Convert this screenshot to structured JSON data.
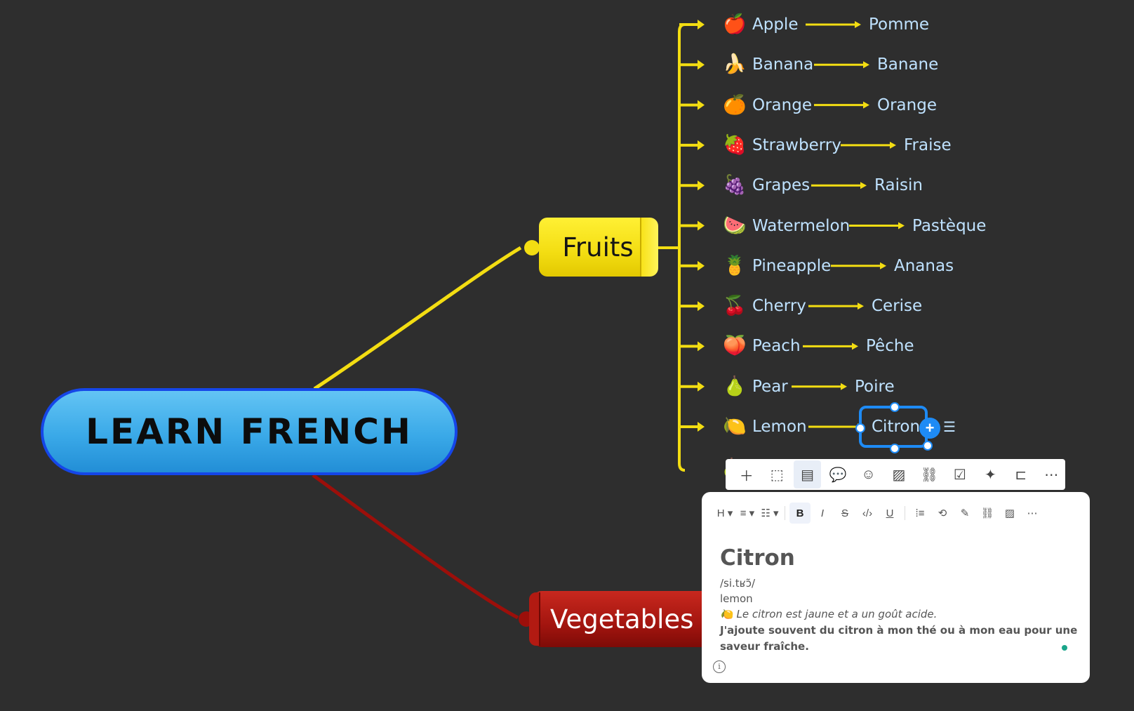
{
  "root": {
    "label": "LEARN FRENCH"
  },
  "branches": {
    "fruits": "Fruits",
    "vegetables": "Vegetables"
  },
  "colors": {
    "fruits": "#f3dd12",
    "vegetables": "#a3150f",
    "root_border": "#1546e8",
    "selection": "#1e8bf5",
    "leaf_text": "#bfe2ff"
  },
  "fruit_items": [
    {
      "emoji": "🍎",
      "en": "Apple",
      "fr": "Pomme"
    },
    {
      "emoji": "🍌",
      "en": "Banana",
      "fr": "Banane"
    },
    {
      "emoji": "🍊",
      "en": "Orange",
      "fr": "Orange"
    },
    {
      "emoji": "🍓",
      "en": "Strawberry",
      "fr": "Fraise"
    },
    {
      "emoji": "🍇",
      "en": "Grapes",
      "fr": "Raisin"
    },
    {
      "emoji": "🍉",
      "en": "Watermelon",
      "fr": "Pastèque"
    },
    {
      "emoji": "🍍",
      "en": "Pineapple",
      "fr": "Ananas"
    },
    {
      "emoji": "🍒",
      "en": "Cherry",
      "fr": "Cerise"
    },
    {
      "emoji": "🍑",
      "en": "Peach",
      "fr": "Pêche"
    },
    {
      "emoji": "🍐",
      "en": "Pear",
      "fr": "Poire"
    },
    {
      "emoji": "🍋",
      "en": "Lemon",
      "fr": "Citron"
    }
  ],
  "selected_node": "Citron",
  "floating_toolbar": [
    "add-topic-icon",
    "text-box-icon",
    "note-icon",
    "comment-icon",
    "emoji-icon",
    "image-icon",
    "link-icon",
    "task-icon",
    "ai-sparkle-icon",
    "structure-icon",
    "more-icon"
  ],
  "note_toolbar": [
    "heading-icon",
    "align-icon",
    "list-icon",
    "bold-icon",
    "italic-icon",
    "strikethrough-icon",
    "code-icon",
    "underline-icon",
    "quote-icon",
    "embed-icon",
    "highlight-icon",
    "link-icon",
    "image-icon",
    "more-icon"
  ],
  "note": {
    "title": "Citron",
    "pronunciation": "/si.tʁɔ̃/",
    "translation": "lemon",
    "example_emoji": "🍋",
    "example": "Le citron est jaune et a un goût acide.",
    "sentence": "J'ajoute souvent du citron à mon thé ou à mon eau pour une",
    "sentence_cont": "saveur fraîche."
  }
}
